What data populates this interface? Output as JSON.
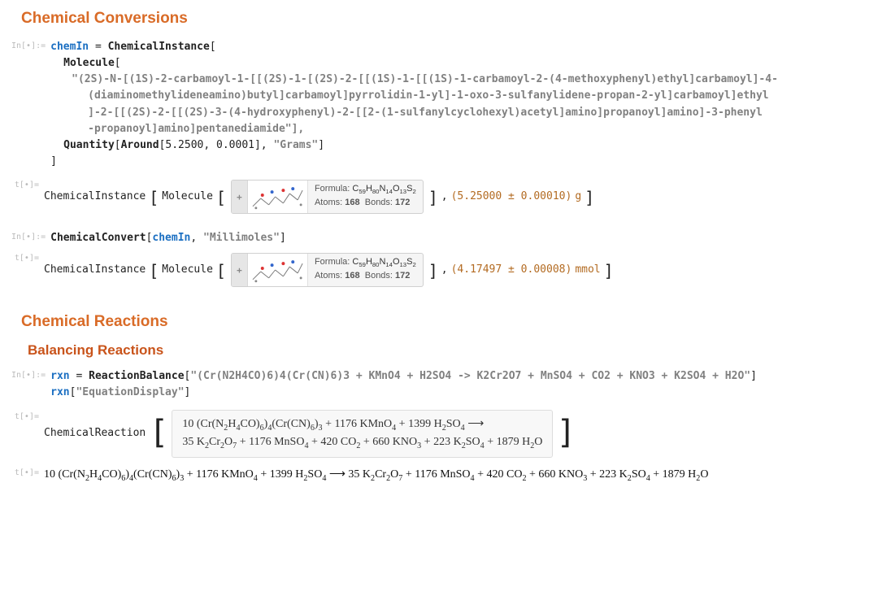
{
  "headings": {
    "chem_conv": "Chemical Conversions",
    "chem_rxn": "Chemical Reactions",
    "balancing": "Balancing Reactions"
  },
  "labels": {
    "in": "In[•]:=",
    "out": "t[•]="
  },
  "in1": {
    "l1a": "chemIn",
    "l1b": " = ",
    "l1c": "ChemicalInstance",
    "l1d": "[",
    "l2a": "Molecule",
    "l2b": "[",
    "l3": "\"(2S)-N-[(1S)-2-carbamoyl-1-[[(2S)-1-[(2S)-2-[[(1S)-1-[[(1S)-1-carbamoyl-2-(4-methoxyphenyl)ethyl]carbamoyl]-4-",
    "l4": "(diaminomethylideneamino)butyl]carbamoyl]pyrrolidin-1-yl]-1-oxo-3-sulfanylidene-propan-2-yl]carbamoyl]ethyl",
    "l5": "]-2-[[(2S)-2-[[(2S)-3-(4-hydroxyphenyl)-2-[[2-(1-sulfanylcyclohexyl)acetyl]amino]propanoyl]amino]-3-phenyl",
    "l6": "-propanoyl]amino]pentanediamide\"],",
    "l7a": "Quantity",
    "l7b": "[",
    "l7c": "Around",
    "l7d": "[5.2500, 0.0001], ",
    "l7e": "\"Grams\"",
    "l7f": "]",
    "l8": "]"
  },
  "mol_meta": {
    "formula_label": "Formula:",
    "formula_html": "C<sub>59</sub>H<sub>80</sub>N<sub>14</sub>O<sub>13</sub>S<sub>2</sub>",
    "atoms_label": "Atoms:",
    "atoms": "168",
    "bonds_label": "Bonds:",
    "bonds": "172"
  },
  "out1": {
    "lead": "ChemicalInstance",
    "mid": "Molecule",
    "qty": "(5.25000 ± 0.00010)",
    "unit": "g"
  },
  "in2": {
    "fn": "ChemicalConvert",
    "arg1": "chemIn",
    "sep": ", ",
    "arg2": "\"Millimoles\"",
    "close": "]",
    "open": "["
  },
  "out2": {
    "lead": "ChemicalInstance",
    "mid": "Molecule",
    "qty": "(4.17497 ± 0.00008)",
    "unit": "mmol"
  },
  "in3": {
    "l1a": "rxn",
    "l1b": " = ",
    "l1c": "ReactionBalance",
    "l1d": "[",
    "l1e": "\"(Cr(N2H4CO)6)4(Cr(CN)6)3 + KMnO4 + H2SO4 -> K2Cr2O7 + MnSO4 + CO2 + KNO3 + K2SO4 + H2O\"",
    "l1f": "]",
    "l2a": "rxn",
    "l2b": "[",
    "l2c": "\"EquationDisplay\"",
    "l2d": "]"
  },
  "out3": {
    "lead": "ChemicalReaction",
    "line1": "10 (Cr(N<sub>2</sub>H<sub>4</sub>CO)<sub>6</sub>)<sub>4</sub>(Cr(CN)<sub>6</sub>)<sub>3</sub> + 1176 KMnO<sub>4</sub> + 1399 H<sub>2</sub>SO<sub>4</sub> ⟶",
    "line2": "35 K<sub>2</sub>Cr<sub>2</sub>O<sub>7</sub> + 1176 MnSO<sub>4</sub> + 420 CO<sub>2</sub> + 660 KNO<sub>3</sub> + 223 K<sub>2</sub>SO<sub>4</sub> + 1879 H<sub>2</sub>O"
  },
  "out4": {
    "eq": "10 (Cr(N<sub>2</sub>H<sub>4</sub>CO)<sub>6</sub>)<sub>4</sub>(Cr(CN)<sub>6</sub>)<sub>3</sub> + 1176 KMnO<sub>4</sub> + 1399 H<sub>2</sub>SO<sub>4</sub> ⟶ 35 K<sub>2</sub>Cr<sub>2</sub>O<sub>7</sub> + 1176 MnSO<sub>4</sub> + 420 CO<sub>2</sub> + 660 KNO<sub>3</sub> + 223 K<sub>2</sub>SO<sub>4</sub> + 1879 H<sub>2</sub>O"
  }
}
